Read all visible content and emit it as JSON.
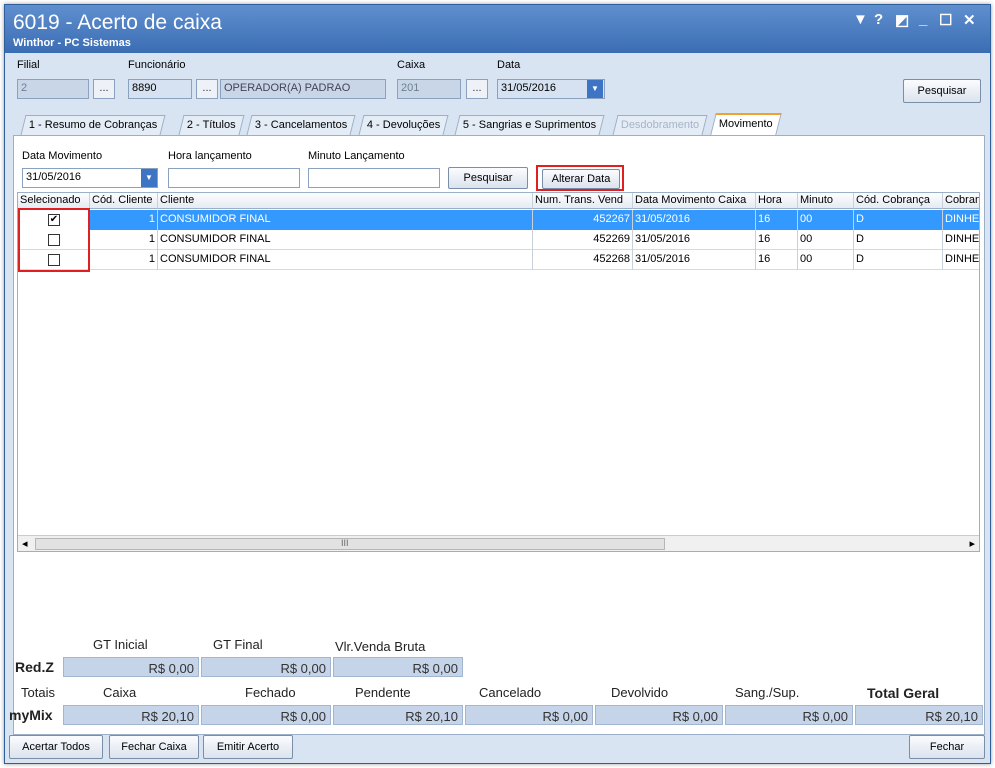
{
  "window": {
    "title": "6019 - Acerto de caixa",
    "subtitle": "Winthor - PC Sistemas",
    "controls": [
      "▼",
      "?",
      "◩",
      "_",
      "☐",
      "✕"
    ]
  },
  "filters": {
    "filial_label": "Filial",
    "filial_value": "2",
    "funcionario_label": "Funcionário",
    "funcionario_code": "8890",
    "funcionario_name": "OPERADOR(A) PADRAO",
    "caixa_label": "Caixa",
    "caixa_value": "201",
    "data_label": "Data",
    "data_value": "31/05/2016",
    "dots": "...",
    "pesquisar": "Pesquisar"
  },
  "tabs": [
    {
      "label": "1 - Resumo de Cobranças"
    },
    {
      "label": "2 - Títulos"
    },
    {
      "label": "3 - Cancelamentos"
    },
    {
      "label": "4 - Devoluções"
    },
    {
      "label": "5 - Sangrias e Suprimentos"
    },
    {
      "label": "Desdobramento"
    },
    {
      "label": "Movimento"
    }
  ],
  "movimento": {
    "data_mov_label": "Data Movimento",
    "data_mov_value": "31/05/2016",
    "hora_label": "Hora lançamento",
    "hora_value": "",
    "minuto_label": "Minuto Lançamento",
    "minuto_value": "",
    "pesquisar": "Pesquisar",
    "alterar_data": "Alterar Data"
  },
  "grid": {
    "columns": [
      "Selecionado",
      "Cód. Cliente",
      "Cliente",
      "Num. Trans. Vend",
      "Data Movimento Caixa",
      "Hora",
      "Minuto",
      "Cód. Cobrança",
      "Cobrança"
    ],
    "rows": [
      {
        "selected": true,
        "cod": "1",
        "cliente": "CONSUMIDOR FINAL",
        "num": "452267",
        "data": "31/05/2016",
        "hora": "16",
        "minuto": "00",
        "codcob": "D",
        "cob": "DINHEIRO"
      },
      {
        "selected": false,
        "cod": "1",
        "cliente": "CONSUMIDOR FINAL",
        "num": "452269",
        "data": "31/05/2016",
        "hora": "16",
        "minuto": "00",
        "codcob": "D",
        "cob": "DINHEIRO"
      },
      {
        "selected": false,
        "cod": "1",
        "cliente": "CONSUMIDOR FINAL",
        "num": "452268",
        "data": "31/05/2016",
        "hora": "16",
        "minuto": "00",
        "codcob": "D",
        "cob": "DINHEIRO"
      }
    ],
    "scroll_left": "◂",
    "scroll_mid": "III",
    "scroll_right": "▸"
  },
  "totals": {
    "gt_inicial_label": "GT Inicial",
    "gt_final_label": "GT Final",
    "vlr_venda_label": "Vlr.Venda Bruta",
    "redz_label": "Red.Z",
    "gt_inicial": "R$ 0,00",
    "gt_final": "R$ 0,00",
    "vlr_venda": "R$ 0,00",
    "totais_label": "Totais",
    "caixa_label": "Caixa",
    "fechado_label": "Fechado",
    "pendente_label": "Pendente",
    "cancelado_label": "Cancelado",
    "devolvido_label": "Devolvido",
    "sang_label": "Sang./Sup.",
    "total_geral_label": "Total Geral",
    "mymix_label": "myMix",
    "caixa": "R$ 20,10",
    "fechado": "R$ 0,00",
    "pendente": "R$ 20,10",
    "cancelado": "R$ 0,00",
    "devolvido": "R$ 0,00",
    "sang": "R$ 0,00",
    "total_geral": "R$ 20,10"
  },
  "footer": {
    "acertar_todos": "Acertar Todos",
    "fechar_caixa": "Fechar Caixa",
    "emitir_acerto": "Emitir Acerto",
    "fechar": "Fechar"
  }
}
